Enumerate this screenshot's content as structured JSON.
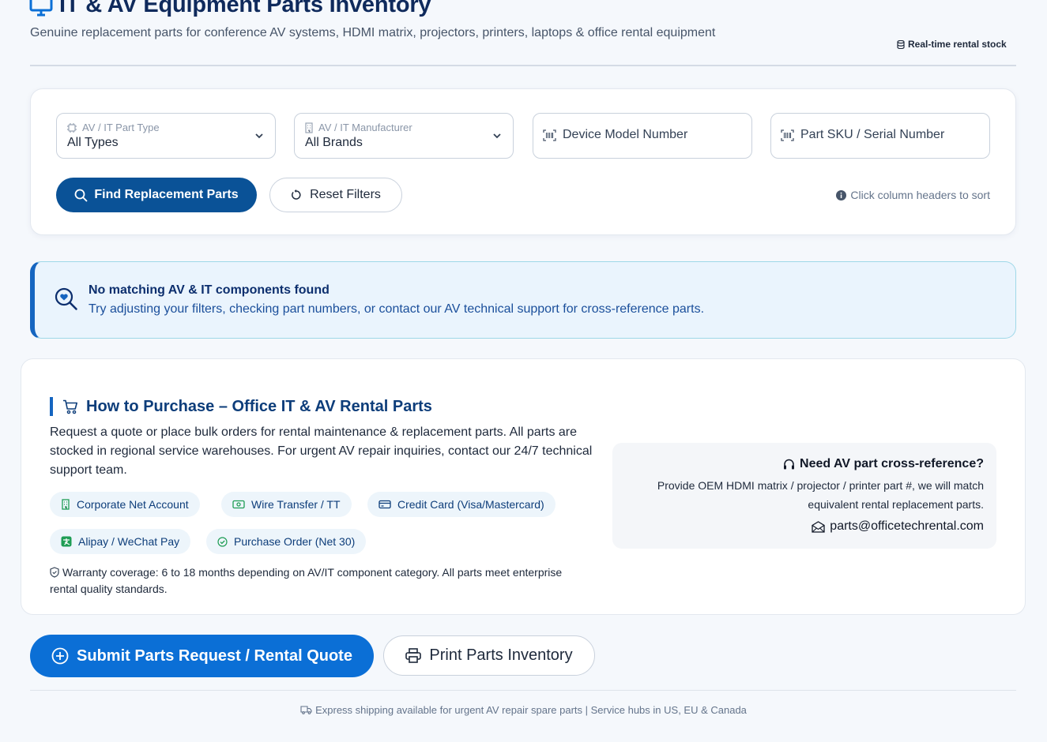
{
  "header": {
    "title": "IT & AV Equipment Parts Inventory",
    "subtitle": "Genuine replacement parts for conference AV systems, HDMI matrix, projectors, printers, laptops & office rental equipment",
    "stock_badge": "Real-time rental stock"
  },
  "filters": {
    "part_type": {
      "label": "AV / IT Part Type",
      "value": "All Types"
    },
    "manufacturer": {
      "label": "AV / IT Manufacturer",
      "value": "All Brands"
    },
    "model_number": {
      "placeholder": "Device Model Number"
    },
    "sku": {
      "placeholder": "Part SKU / Serial Number"
    },
    "find_button": "Find Replacement Parts",
    "reset_button": "Reset Filters",
    "sort_hint": "Click column headers to sort"
  },
  "alert": {
    "title": "No matching AV & IT components found",
    "message": "Try adjusting your filters, checking part numbers, or contact our AV technical support for cross-reference parts."
  },
  "purchase": {
    "heading": "How to Purchase – Office IT & AV Rental Parts",
    "description": "Request a quote or place bulk orders for rental maintenance & replacement parts. All parts are stocked in regional service warehouses. For urgent AV repair inquiries, contact our 24/7 technical support team.",
    "payment_methods": [
      {
        "label": "Corporate Net Account",
        "icon": "building-icon"
      },
      {
        "label": "Wire Transfer / TT",
        "icon": "cash-icon"
      },
      {
        "label": "Credit Card (Visa/Mastercard)",
        "icon": "credit-card-icon"
      },
      {
        "label": "Alipay / WeChat Pay",
        "icon": "alipay-icon"
      },
      {
        "label": "Purchase Order (Net 30)",
        "icon": "check-circle-icon"
      }
    ],
    "warranty": "Warranty coverage: 6 to 18 months depending on AV/IT component category. All parts meet enterprise rental quality standards.",
    "support": {
      "title": "Need AV part cross-reference?",
      "text": "Provide OEM HDMI matrix / projector / printer part #, we will match equivalent rental replacement parts.",
      "email": "parts@officetechrental.com"
    }
  },
  "actions": {
    "submit": "Submit Parts Request / Rental Quote",
    "print": "Print Parts Inventory"
  },
  "footer": {
    "note": "Express shipping available for urgent AV repair spare parts | Service hubs in US, EU & Canada"
  },
  "colors": {
    "primary": "#0a5297",
    "accent": "#0b6fd6",
    "alert_bg": "#eaf4fd",
    "chip_bg": "#edf5fb"
  }
}
